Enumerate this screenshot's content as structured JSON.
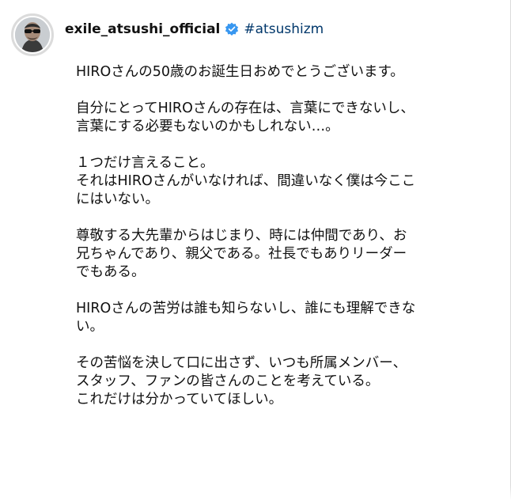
{
  "post": {
    "username": "exile_atsushi_official",
    "hashtag": "#atsushizm",
    "verified_color": "#3897f0",
    "caption": [
      [
        "HIROさんの50歳のお誕生日おめでとうございます。"
      ],
      [
        "自分にとってHIROさんの存在は、言葉にできないし、",
        "言葉にする必要もないのかもしれない…。"
      ],
      [
        "１つだけ言えること。",
        "それはHIROさんがいなければ、間違いなく僕は今ここ",
        "にはいない。"
      ],
      [
        "尊敬する大先輩からはじまり、時には仲間であり、お",
        "兄ちゃんであり、親父である。社長でもありリーダー",
        "でもある。"
      ],
      [
        "HIROさんの苦労は誰も知らないし、誰にも理解できな",
        "い。"
      ],
      [
        "その苦悩を決して口に出さず、いつも所属メンバー、",
        "スタッフ、ファンの皆さんのことを考えている。",
        "これだけは分かっていてほしい。"
      ]
    ]
  }
}
